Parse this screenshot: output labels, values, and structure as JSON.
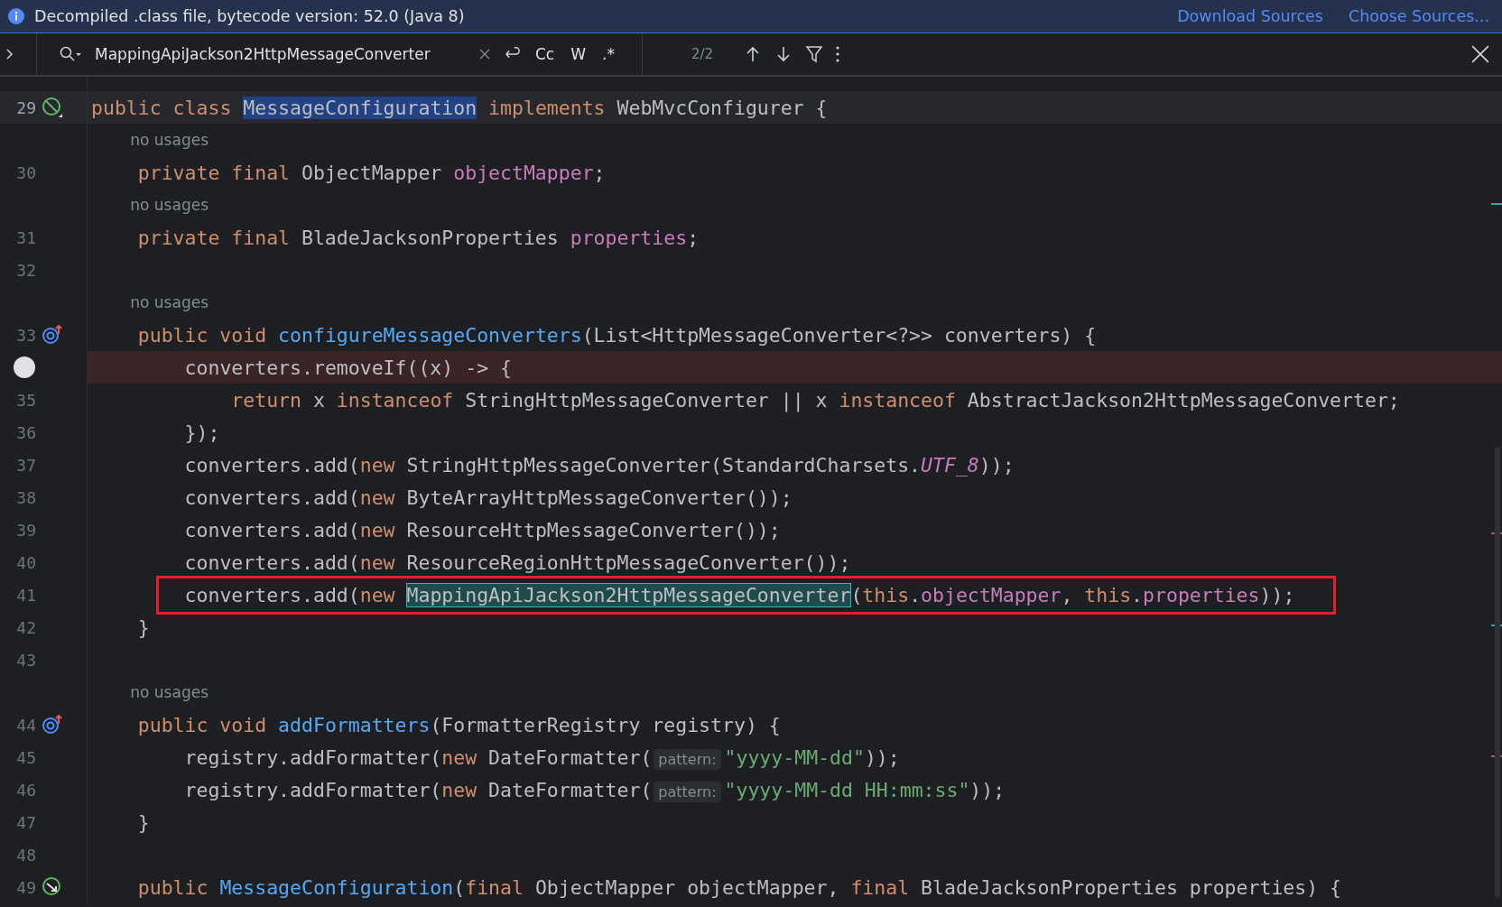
{
  "info_bar": {
    "message": "Decompiled .class file, bytecode version: 52.0 (Java 8)",
    "links": [
      "Download Sources",
      "Choose Sources..."
    ]
  },
  "search": {
    "query": "MappingApiJackson2HttpMessageConverter",
    "options": [
      "Cc",
      "W",
      ".*"
    ],
    "count": "2/2"
  },
  "lines": [
    {
      "kind": "code",
      "number": "29",
      "marker": {
        "kind": "blocked"
      },
      "current": true,
      "tokens": [
        {
          "t": "public class ",
          "kind": "keyword"
        },
        {
          "t": "MessageConfiguration",
          "kind": "match"
        },
        {
          "t": " implements",
          "kind": "keyword"
        },
        {
          "t": " WebMvcConfigurer {",
          "kind": "plain"
        }
      ]
    },
    {
      "kind": "hint",
      "text": "no usages"
    },
    {
      "kind": "code",
      "number": "30",
      "tokens": [
        {
          "t": "    private final ",
          "kind": "keyword"
        },
        {
          "t": "ObjectMapper ",
          "kind": "plain"
        },
        {
          "t": "objectMapper",
          "kind": "field"
        },
        {
          "t": ";",
          "kind": "plain"
        }
      ]
    },
    {
      "kind": "hint",
      "text": "no usages"
    },
    {
      "kind": "code",
      "number": "31",
      "tokens": [
        {
          "t": "    private final ",
          "kind": "keyword"
        },
        {
          "t": "BladeJacksonProperties ",
          "kind": "plain"
        },
        {
          "t": "properties",
          "kind": "field"
        },
        {
          "t": ";",
          "kind": "plain"
        }
      ]
    },
    {
      "kind": "code",
      "number": "32"
    },
    {
      "kind": "hint",
      "text": "no usages"
    },
    {
      "kind": "code",
      "number": "33",
      "marker": {
        "kind": "override"
      },
      "tokens": [
        {
          "t": "    public void ",
          "kind": "keyword"
        },
        {
          "t": "configureMessageConverters",
          "kind": "method"
        },
        {
          "t": "(List<HttpMessageConverter<?>> converters) {",
          "kind": "plain"
        }
      ]
    },
    {
      "kind": "code",
      "breakpoint": true,
      "tokens": [
        {
          "t": "        converters.removeIf((x) -> {",
          "kind": "plain"
        }
      ]
    },
    {
      "kind": "code",
      "number": "35",
      "tokens": [
        {
          "t": "            return",
          "kind": "keyword"
        },
        {
          "t": " x ",
          "kind": "plain"
        },
        {
          "t": "instanceof",
          "kind": "keyword"
        },
        {
          "t": " StringHttpMessageConverter || x ",
          "kind": "plain"
        },
        {
          "t": "instanceof",
          "kind": "keyword"
        },
        {
          "t": " AbstractJackson2HttpMessageConverter;",
          "kind": "plain"
        }
      ]
    },
    {
      "kind": "code",
      "number": "36",
      "tokens": [
        {
          "t": "        });",
          "kind": "plain"
        }
      ]
    },
    {
      "kind": "code",
      "number": "37",
      "tokens": [
        {
          "t": "        converters.add(",
          "kind": "plain"
        },
        {
          "t": "new",
          "kind": "keyword"
        },
        {
          "t": " StringHttpMessageConverter(StandardCharsets.",
          "kind": "plain"
        },
        {
          "t": "UTF_8",
          "kind": "static"
        },
        {
          "t": "));",
          "kind": "plain"
        }
      ]
    },
    {
      "kind": "code",
      "number": "38",
      "tokens": [
        {
          "t": "        converters.add(",
          "kind": "plain"
        },
        {
          "t": "new",
          "kind": "keyword"
        },
        {
          "t": " ByteArrayHttpMessageConverter());",
          "kind": "plain"
        }
      ]
    },
    {
      "kind": "code",
      "number": "39",
      "tokens": [
        {
          "t": "        converters.add(",
          "kind": "plain"
        },
        {
          "t": "new",
          "kind": "keyword"
        },
        {
          "t": " ResourceHttpMessageConverter());",
          "kind": "plain"
        }
      ]
    },
    {
      "kind": "code",
      "number": "40",
      "tokens": [
        {
          "t": "        converters.add(",
          "kind": "plain"
        },
        {
          "t": "new",
          "kind": "keyword"
        },
        {
          "t": " ResourceRegionHttpMessageConverter());",
          "kind": "plain"
        }
      ]
    },
    {
      "kind": "code",
      "number": "41",
      "boxed": true,
      "tokens": [
        {
          "t": "        converters.add(",
          "kind": "plain"
        },
        {
          "t": "new ",
          "kind": "keyword"
        },
        {
          "t": "MappingApiJackson2HttpMessageConverter",
          "kind": "current-match"
        },
        {
          "t": "(",
          "kind": "plain"
        },
        {
          "t": "this",
          "kind": "keyword"
        },
        {
          "t": ".",
          "kind": "plain"
        },
        {
          "t": "objectMapper",
          "kind": "field"
        },
        {
          "t": ", ",
          "kind": "plain"
        },
        {
          "t": "this",
          "kind": "keyword"
        },
        {
          "t": ".",
          "kind": "plain"
        },
        {
          "t": "properties",
          "kind": "field"
        },
        {
          "t": "));",
          "kind": "plain"
        }
      ]
    },
    {
      "kind": "code",
      "number": "42",
      "tokens": [
        {
          "t": "    }",
          "kind": "plain"
        }
      ]
    },
    {
      "kind": "code",
      "number": "43"
    },
    {
      "kind": "hint",
      "text": "no usages"
    },
    {
      "kind": "code",
      "number": "44",
      "marker": {
        "kind": "override"
      },
      "tokens": [
        {
          "t": "    public void ",
          "kind": "keyword"
        },
        {
          "t": "addFormatters",
          "kind": "method"
        },
        {
          "t": "(FormatterRegistry registry) {",
          "kind": "plain"
        }
      ]
    },
    {
      "kind": "code",
      "number": "45",
      "tokens": [
        {
          "t": "        registry.addFormatter(",
          "kind": "plain"
        },
        {
          "t": "new",
          "kind": "keyword"
        },
        {
          "t": " DateFormatter(",
          "kind": "plain"
        },
        {
          "t": "pattern:",
          "kind": "inlay"
        },
        {
          "t": "\"yyyy-MM-dd\"",
          "kind": "string"
        },
        {
          "t": "));",
          "kind": "plain"
        }
      ]
    },
    {
      "kind": "code",
      "number": "46",
      "tokens": [
        {
          "t": "        registry.addFormatter(",
          "kind": "plain"
        },
        {
          "t": "new",
          "kind": "keyword"
        },
        {
          "t": " DateFormatter(",
          "kind": "plain"
        },
        {
          "t": "pattern:",
          "kind": "inlay"
        },
        {
          "t": "\"yyyy-MM-dd HH:mm:ss\"",
          "kind": "string"
        },
        {
          "t": "));",
          "kind": "plain"
        }
      ]
    },
    {
      "kind": "code",
      "number": "47",
      "tokens": [
        {
          "t": "    }",
          "kind": "plain"
        }
      ]
    },
    {
      "kind": "code",
      "number": "48"
    },
    {
      "kind": "code",
      "number": "49",
      "marker": {
        "kind": "implemented"
      },
      "tokens": [
        {
          "t": "    public ",
          "kind": "keyword"
        },
        {
          "t": "MessageConfiguration",
          "kind": "method"
        },
        {
          "t": "(",
          "kind": "plain"
        },
        {
          "t": "final",
          "kind": "keyword"
        },
        {
          "t": " ObjectMapper objectMapper, ",
          "kind": "plain"
        },
        {
          "t": "final",
          "kind": "keyword"
        },
        {
          "t": " BladeJacksonProperties properties) {",
          "kind": "plain"
        }
      ]
    }
  ]
}
